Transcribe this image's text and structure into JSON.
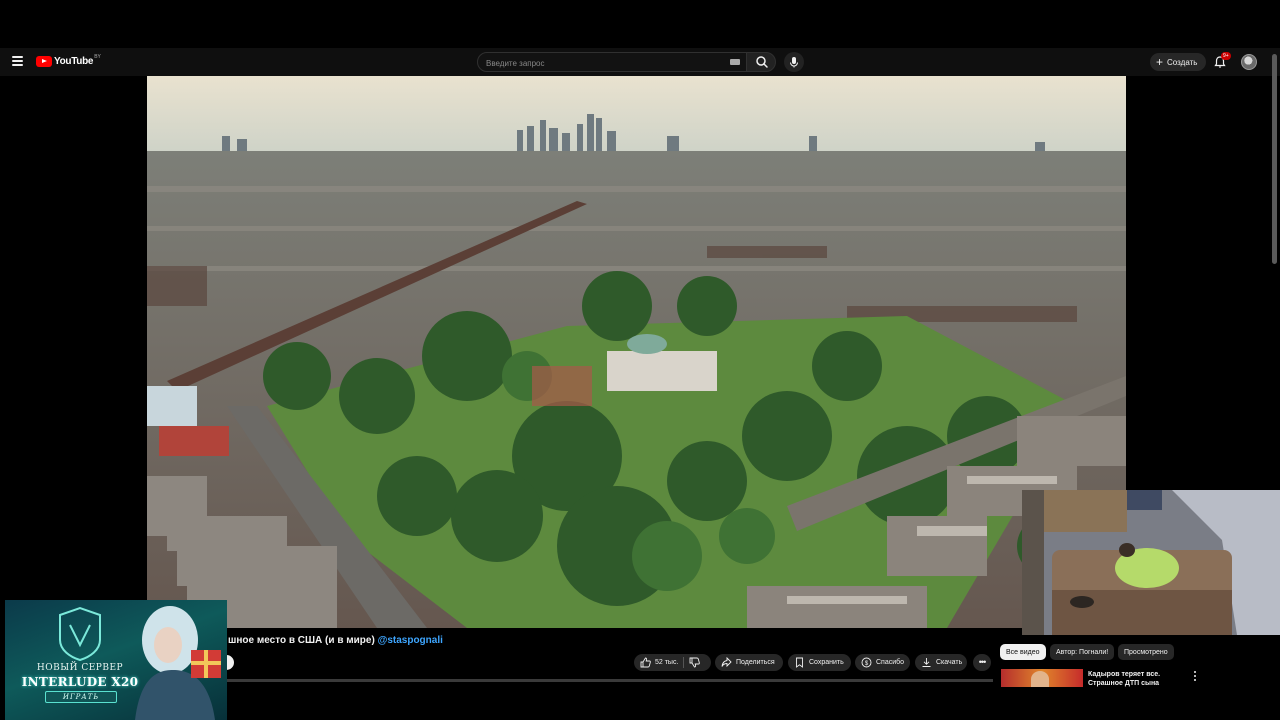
{
  "header": {
    "logo_text": "YouTube",
    "logo_region": "BY",
    "search_placeholder": "Введите запрос",
    "create_label": "Создать",
    "notifications_badge": "9+"
  },
  "video": {
    "title_fragment": "шное место в США (и в мире)",
    "channel_handle": "@staspognali"
  },
  "actions": {
    "likes": "52 тыс.",
    "share": "Поделиться",
    "save": "Сохранить",
    "thanks": "Спасибо",
    "download": "Скачать"
  },
  "sidebar": {
    "chips": [
      "Все видео",
      "Автор: Погнали!",
      "Просмотрено"
    ],
    "active_chip": "Все видео",
    "recommended": [
      {
        "title": "Кадыров теряет все. Страшное ДТП сына"
      }
    ]
  },
  "ad": {
    "line1": "НОВЫЙ СЕРВЕР",
    "line2": "INTERLUDE X20",
    "button": "ИГРАТЬ"
  },
  "colors": {
    "background": "#000000",
    "topbar": "#0f0f0f",
    "brand_red": "#ff0000",
    "link_blue": "#3ea6ff",
    "pill_bg": "#272727"
  }
}
